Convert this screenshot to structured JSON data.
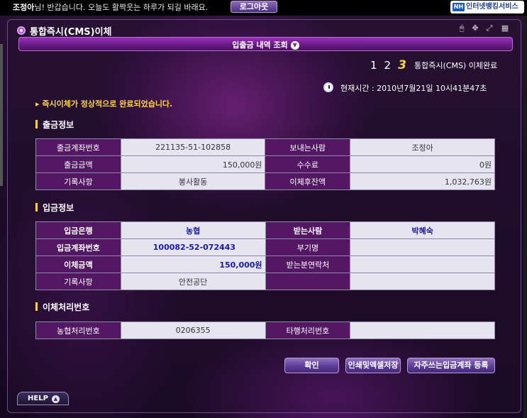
{
  "topbar": {
    "user_name": "조정아",
    "greeting": "님! 반갑습니다. 오늘도 활짝웃는 하루가 되길 바래요.",
    "logout_label": "로그아웃",
    "brand_badge": "NH",
    "brand_label": "인터넷뱅킹서비스"
  },
  "window": {
    "title": "통합즉시(CMS)이체",
    "menu_label": "입출금 내역 조회",
    "tools": [
      "mouse-icon",
      "move-icon",
      "expand-icon",
      "calculator-icon"
    ]
  },
  "steps": {
    "items": [
      "1",
      "2",
      "3"
    ],
    "current_label": "통합즉시(CMS) 이체완료"
  },
  "time": {
    "text": "현재시간 : 2010년7월21일 10시41분47초"
  },
  "message": "즉시이체가 정상적으로 완료되었습니다.",
  "withdraw": {
    "title": "출금정보",
    "rows": [
      {
        "h1": "출금계좌번호",
        "v1": "221135-51-102858",
        "h2": "보내는사람",
        "v2": "조정아"
      },
      {
        "h1": "출금금액",
        "v1": "150,000원",
        "h2": "수수료",
        "v2": "0원"
      },
      {
        "h1": "기록사항",
        "v1": "봉사활동",
        "h2": "이체후잔액",
        "v2": "1,032,763원"
      }
    ]
  },
  "deposit": {
    "title": "입금정보",
    "rows": [
      {
        "h1": "입금은행",
        "v1": "농협",
        "h2": "받는사람",
        "v2": "박혜숙"
      },
      {
        "h1": "입금계좌번호",
        "v1": "100082-52-072443",
        "h2": "부기명",
        "v2": ""
      },
      {
        "h1": "이체금액",
        "v1": "150,000원",
        "h2": "받는분연락처",
        "v2": ""
      },
      {
        "h1": "기록사항",
        "v1": "안전공단",
        "h2": "",
        "v2": ""
      }
    ]
  },
  "process": {
    "title": "이체처리번호",
    "rows": [
      {
        "h1": "농협처리번호",
        "v1": "0206355",
        "h2": "타행처리번호",
        "v2": ""
      }
    ]
  },
  "buttons": {
    "confirm": "확인",
    "print_save": "인쇄및엑셀저장",
    "register": "자주쓰는입금계좌 등록"
  },
  "help_label": "HELP",
  "colors": {
    "accent_yellow": "#ffd347",
    "header_purple": "#531764",
    "cell_bg": "#e7e4f2",
    "highlight_blue": "#1a1aa0"
  }
}
